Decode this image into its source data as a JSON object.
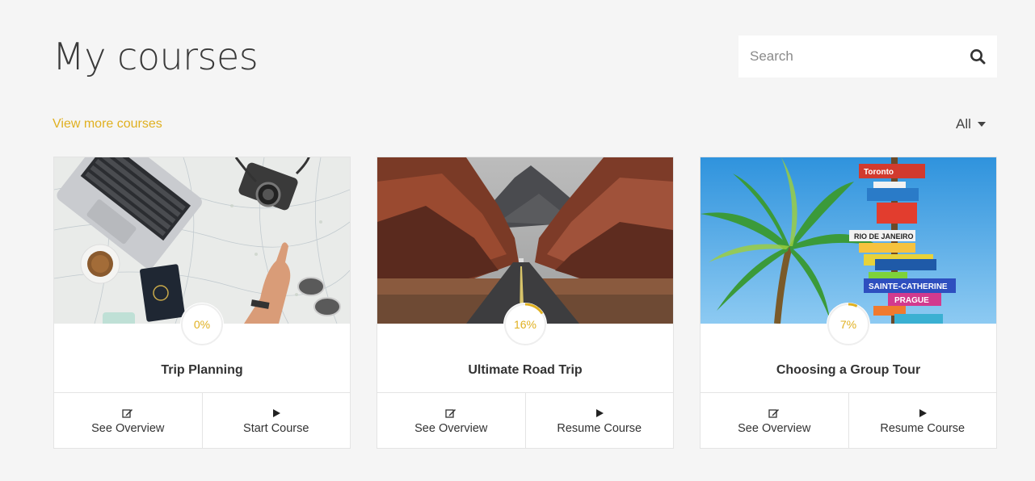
{
  "header": {
    "title": "My courses"
  },
  "search": {
    "placeholder": "Search"
  },
  "links": {
    "view_more": "View more courses"
  },
  "filter": {
    "label": "All"
  },
  "accent_color": "#e0b020",
  "courses": [
    {
      "title": "Trip Planning",
      "progress_label": "0%",
      "progress": 0,
      "overview_label": "See Overview",
      "start_label": "Start Course"
    },
    {
      "title": "Ultimate Road Trip",
      "progress_label": "16%",
      "progress": 0.16,
      "overview_label": "See Overview",
      "start_label": "Resume Course"
    },
    {
      "title": "Choosing a Group Tour",
      "progress_label": "7%",
      "progress": 0.07,
      "overview_label": "See Overview",
      "start_label": "Resume Course"
    }
  ]
}
